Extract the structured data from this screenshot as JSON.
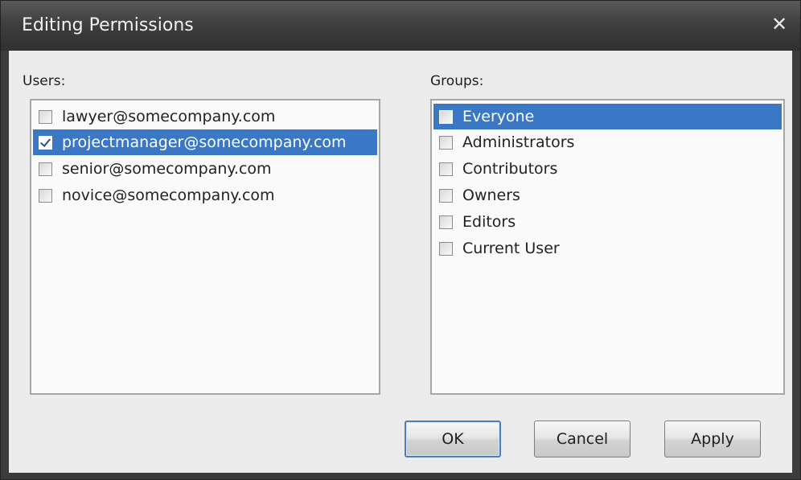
{
  "window": {
    "title": "Editing Permissions",
    "close_symbol": "✕"
  },
  "users": {
    "label": "Users:",
    "items": [
      {
        "label": "lawyer@somecompany.com",
        "checked": false,
        "selected": false
      },
      {
        "label": "projectmanager@somecompany.com",
        "checked": true,
        "selected": true
      },
      {
        "label": "senior@somecompany.com",
        "checked": false,
        "selected": false
      },
      {
        "label": "novice@somecompany.com",
        "checked": false,
        "selected": false
      }
    ]
  },
  "groups": {
    "label": "Groups:",
    "items": [
      {
        "label": "Everyone",
        "checked": false,
        "selected": true
      },
      {
        "label": "Administrators",
        "checked": false,
        "selected": false
      },
      {
        "label": "Contributors",
        "checked": false,
        "selected": false
      },
      {
        "label": "Owners",
        "checked": false,
        "selected": false
      },
      {
        "label": "Editors",
        "checked": false,
        "selected": false
      },
      {
        "label": "Current User",
        "checked": false,
        "selected": false
      }
    ]
  },
  "buttons": {
    "ok": "OK",
    "cancel": "Cancel",
    "apply": "Apply"
  },
  "colors": {
    "selection": "#3a78c6",
    "titlebar": "#3f3f3f",
    "client": "#ececec"
  }
}
